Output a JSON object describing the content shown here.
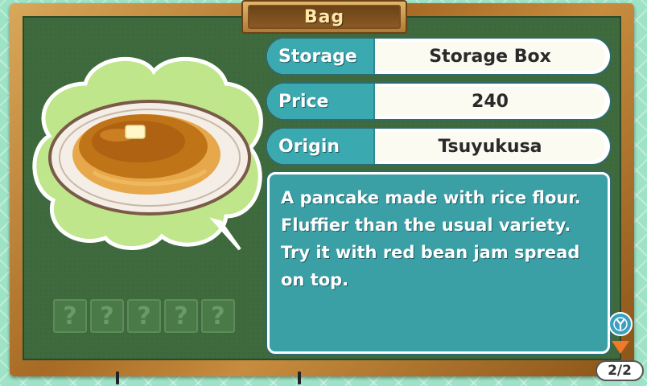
{
  "window": {
    "title": "Bag"
  },
  "item": {
    "image_icon": "rice-flour-pancake-plate",
    "info_rows": [
      {
        "label": "Storage",
        "value": "Storage Box"
      },
      {
        "label": "Price",
        "value": "240"
      },
      {
        "label": "Origin",
        "value": "Tsuyukusa"
      }
    ],
    "description_lines": [
      "A pancake made with rice flour.",
      "Fluffier than the usual variety.",
      "Try it with red bean jam spread",
      "on top."
    ]
  },
  "unknown_slots": [
    "?",
    "?",
    "?",
    "?",
    "?"
  ],
  "controls": {
    "y_button_icon": "y-button-icon",
    "next_arrow_icon": "down-arrow-icon",
    "page_indicator": "2/2"
  },
  "colors": {
    "accent_teal": "#3aa9b0",
    "board_green": "#3e6a3e",
    "frame_wood": "#b07a34",
    "arrow_orange": "#f2782a"
  }
}
